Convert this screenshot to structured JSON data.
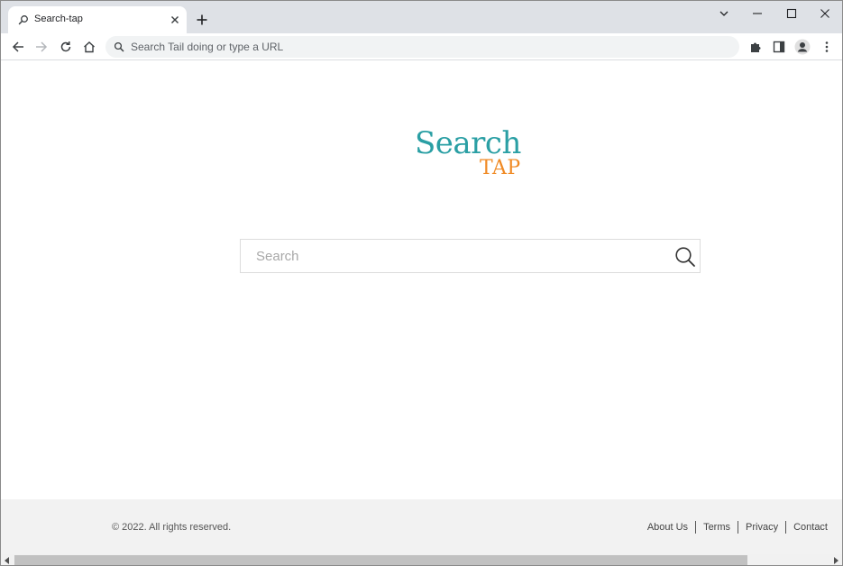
{
  "browser": {
    "tab_title": "Search-tap",
    "omnibox_placeholder": "Search Tail doing or type a URL"
  },
  "logo": {
    "word_search": "Search",
    "word_tap": "TAP"
  },
  "search": {
    "placeholder": "Search",
    "value": ""
  },
  "footer": {
    "copyright": "© 2022. All rights reserved.",
    "links": [
      "About Us",
      "Terms",
      "Privacy",
      "Contact"
    ]
  },
  "colors": {
    "logo_search": "#2a9fa4",
    "logo_tap": "#f08a24",
    "tabstrip": "#dee1e6",
    "footer_bg": "#f2f2f2"
  },
  "icons": {
    "tab_favicon": "search-icon",
    "back": "arrow-left-icon",
    "forward": "arrow-right-icon",
    "reload": "reload-icon",
    "home": "home-icon",
    "extensions": "puzzle-icon",
    "side_panel": "side-panel-icon",
    "profile": "profile-icon",
    "menu": "more-vert-icon"
  }
}
